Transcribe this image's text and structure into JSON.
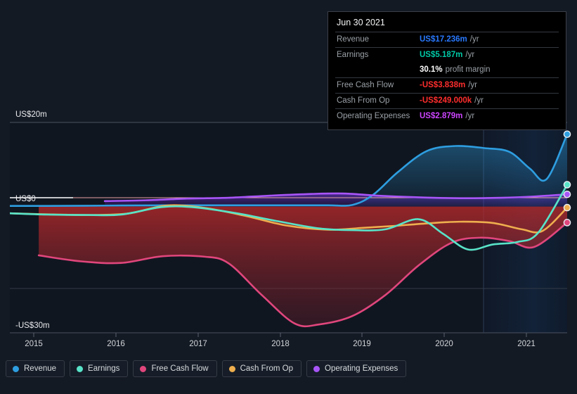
{
  "tooltip": {
    "date": "Jun 30 2021",
    "rows": [
      {
        "label": "Revenue",
        "value": "US$17.236m",
        "unit": "/yr",
        "color": "#2979ff"
      },
      {
        "label": "Earnings",
        "value": "US$5.187m",
        "unit": "/yr",
        "color": "#00c9a7"
      },
      {
        "label": "",
        "value": "30.1%",
        "unit": "profit margin",
        "color": "#ffffff"
      },
      {
        "label": "Free Cash Flow",
        "value": "-US$3.838m",
        "unit": "/yr",
        "color": "#ff2d2d"
      },
      {
        "label": "Cash From Op",
        "value": "-US$249.000k",
        "unit": "/yr",
        "color": "#ff2d2d"
      },
      {
        "label": "Operating Expenses",
        "value": "US$2.879m",
        "unit": "/yr",
        "color": "#cc44ff"
      }
    ]
  },
  "legend": {
    "items": [
      {
        "label": "Revenue",
        "color": "#2e9ee0"
      },
      {
        "label": "Earnings",
        "color": "#58e3c8"
      },
      {
        "label": "Free Cash Flow",
        "color": "#e0467c"
      },
      {
        "label": "Cash From Op",
        "color": "#eeae4e"
      },
      {
        "label": "Operating Expenses",
        "color": "#a855f7"
      }
    ]
  },
  "axis": {
    "y_labels": [
      "US$20m",
      "US$0",
      "-US$30m"
    ],
    "x_labels": [
      "2015",
      "2016",
      "2017",
      "2018",
      "2019",
      "2020",
      "2021"
    ]
  },
  "chart_data": {
    "type": "area",
    "title": "",
    "xlabel": "",
    "ylabel": "US$",
    "ylim": [
      -30,
      20
    ],
    "xlim": [
      2014.85,
      2021.6
    ],
    "grid": true,
    "legend_position": "bottom",
    "y_ticks": [
      20,
      0,
      -15,
      -30
    ],
    "y_tick_labels": [
      "US$20m",
      "US$0",
      "",
      "-US$30m"
    ],
    "x_ticks": [
      2015,
      2016,
      2017,
      2018,
      2019,
      2020,
      2021
    ],
    "forecast_divider_x": 2020.9,
    "series": [
      {
        "name": "Revenue",
        "color": "#2e9ee0",
        "x": [
          2014.85,
          2015.3,
          2015.8,
          2016.2,
          2016.7,
          2017.2,
          2017.7,
          2018.2,
          2018.7,
          2019.0,
          2019.25,
          2019.55,
          2019.9,
          2020.25,
          2020.6,
          2020.9,
          2021.15,
          2021.35,
          2021.6
        ],
        "y": [
          0.15,
          0.15,
          0.2,
          0.25,
          0.3,
          0.3,
          0.3,
          0.3,
          0.3,
          0.4,
          2.8,
          8.2,
          13.2,
          14.4,
          13.9,
          13.0,
          9.0,
          6.5,
          17.2
        ]
      },
      {
        "name": "Earnings",
        "color": "#58e3c8",
        "x": [
          2014.85,
          2015.3,
          2015.8,
          2016.2,
          2016.7,
          2017.1,
          2017.6,
          2018.1,
          2018.6,
          2019.0,
          2019.4,
          2019.8,
          2020.1,
          2020.4,
          2020.7,
          2021.0,
          2021.25,
          2021.6
        ],
        "y": [
          -1.6,
          -1.9,
          -2.0,
          -1.9,
          -0.1,
          -0.2,
          -1.6,
          -3.5,
          -5.2,
          -5.6,
          -5.4,
          -3.0,
          -6.5,
          -10.2,
          -9.0,
          -8.4,
          -6.2,
          5.2
        ]
      },
      {
        "name": "Free Cash Flow",
        "color": "#e0467c",
        "x": [
          2015.2,
          2015.7,
          2016.2,
          2016.7,
          2017.2,
          2017.5,
          2017.9,
          2018.3,
          2018.6,
          2019.0,
          2019.4,
          2019.8,
          2020.2,
          2020.55,
          2020.9,
          2021.2,
          2021.6
        ],
        "y": [
          -11.6,
          -13.0,
          -13.4,
          -11.8,
          -11.9,
          -13.5,
          -21.0,
          -27.8,
          -28.0,
          -26.0,
          -21.0,
          -14.0,
          -8.6,
          -7.4,
          -8.2,
          -9.6,
          -3.8
        ]
      },
      {
        "name": "Cash From Op",
        "color": "#eeae4e",
        "x": [
          2014.85,
          2015.4,
          2015.9,
          2016.3,
          2016.75,
          2017.2,
          2017.7,
          2018.2,
          2018.7,
          2019.1,
          2019.5,
          2019.9,
          2020.3,
          2020.7,
          2021.05,
          2021.3,
          2021.6
        ],
        "y": [
          -1.6,
          -1.9,
          -2.0,
          -1.6,
          0.25,
          -0.3,
          -2.2,
          -4.5,
          -5.5,
          -5.1,
          -4.6,
          -4.0,
          -3.6,
          -3.9,
          -5.4,
          -5.8,
          -0.25
        ]
      },
      {
        "name": "Operating Expenses",
        "color": "#a855f7",
        "x": [
          2016.0,
          2016.5,
          2017.0,
          2017.5,
          2018.0,
          2018.5,
          2018.9,
          2019.3,
          2019.8,
          2020.3,
          2020.8,
          2021.2,
          2021.6
        ],
        "y": [
          1.3,
          1.5,
          1.9,
          2.1,
          2.6,
          3.0,
          3.1,
          2.6,
          2.2,
          2.0,
          2.1,
          2.4,
          2.9
        ]
      }
    ]
  }
}
